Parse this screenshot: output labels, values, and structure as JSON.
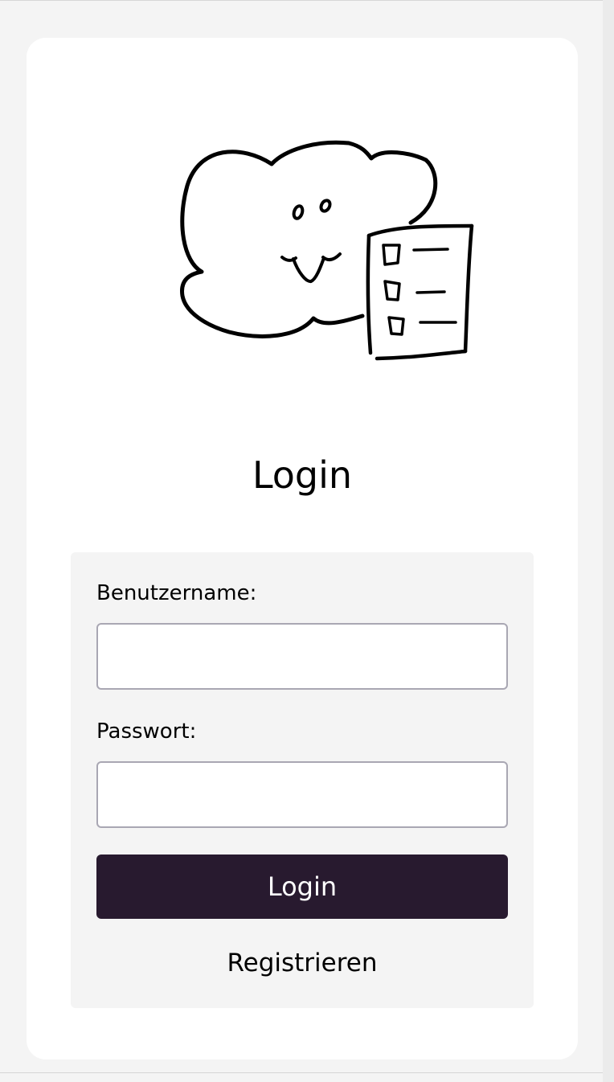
{
  "page": {
    "title": "Login"
  },
  "illustration": {
    "icon": "cloud-with-checklist-icon"
  },
  "form": {
    "username_label": "Benutzername:",
    "username_value": "",
    "password_label": "Passwort:",
    "password_value": "",
    "login_button_label": "Login",
    "register_link_label": "Registrieren"
  },
  "colors": {
    "page_background": "#f4f4f4",
    "card_background": "#ffffff",
    "form_background": "#f4f4f4",
    "button_background": "#281a2f",
    "button_text": "#ffffff",
    "input_border": "#a9a7b3"
  }
}
